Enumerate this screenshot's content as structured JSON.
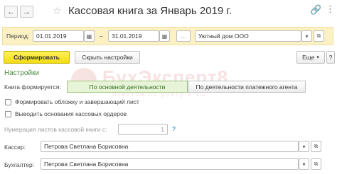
{
  "window": {
    "title": "Кассовая книга за Январь 2019 г."
  },
  "period": {
    "label": "Период:",
    "from": "01.01.2019",
    "separator": "–",
    "to": "31.01.2019",
    "more_label": "...",
    "organization": "Уютный дом ООО"
  },
  "toolbar": {
    "generate_label": "Сформировать",
    "settings_label": "Скрыть настройки",
    "more_label": "Еще",
    "help_label": "?"
  },
  "settings": {
    "section_title": "Настройки",
    "book_formed_label": "Книга формируется:",
    "options": [
      {
        "label": "По основной деятельности",
        "active": true
      },
      {
        "label": "По деятельности платежного агента",
        "active": false
      }
    ],
    "cover_label": "Формировать обложку и завершающий лист",
    "reasons_label": "Выводить основания кассовых ордеров",
    "numbering_label": "Нумерация листов кассовой книги с:",
    "numbering_value": "1",
    "numbering_help": "?",
    "cashier_label": "Кассир:",
    "cashier_value": "Петрова Светлана Борисовна",
    "accountant_label": "Бухгалтер:",
    "accountant_value": "Петрова Светлана Борисовна"
  },
  "watermark": {
    "brand": "БухЭксперт8",
    "tagline": "ответов по учету в 1С"
  },
  "colors": {
    "accent_yellow": "#f2dc16",
    "period_bg": "#fbf1c3",
    "section_green": "#4a8a3a",
    "watermark_red": "#c62828"
  }
}
